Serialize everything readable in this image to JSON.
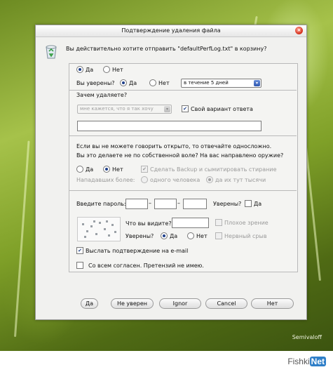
{
  "dialog": {
    "title": "Подтверждение удаления файла",
    "message": "Вы действительно хотите отправить \"defaultPerfLog.txt\" в корзину?"
  },
  "main_choice": {
    "yes": "Да",
    "no": "Нет",
    "selected": "yes"
  },
  "sure": {
    "label": "Вы уверены?",
    "yes": "Да",
    "no": "Нет",
    "selected": "yes",
    "when_value": "в течение 5 дней"
  },
  "why": {
    "label": "Зачем удаляете?",
    "reason_value": "мне кажется, что я так хочу",
    "own_answer_label": "Свой вариант ответа",
    "own_answer_checked": true,
    "own_answer_value": ""
  },
  "honest": {
    "line1": "Если вы не можете говорить открыто, то отвечайте односложно.",
    "line2": "Вы это делаете не по собственной воле? На вас направлено оружие?",
    "yes": "Да",
    "no": "Нет",
    "selected": "no",
    "backup_label": "Сделать Backup и сымитировать стирание",
    "backup_checked": true,
    "attackers_label": "Нападавших более:",
    "one_person": "одного человека",
    "thousands": "да их тут тысячи",
    "attackers_selected": "thousands"
  },
  "password": {
    "label": "Введите пароль:",
    "part1": "",
    "part2": "",
    "part3": "",
    "dash1": "–",
    "dash2": "–",
    "sure_label": "Уверены?",
    "sure_yes": "Да"
  },
  "captcha": {
    "question": "Что вы видите?",
    "answer": "",
    "bad_vision": "Плохое зрение",
    "sure_label": "Уверены?",
    "yes": "Да",
    "no": "Нет",
    "selected": "yes",
    "nervous": "Нервный срыв"
  },
  "send_confirmation": {
    "label": "Выслать подтверждение на e-mail",
    "checked": true
  },
  "agree": {
    "label": "Со всем согласен. Претензий не имею.",
    "checked": false
  },
  "buttons": {
    "yes": "Да",
    "not_sure": "Не уверен",
    "ignore": "Ignor",
    "cancel": "Cancel",
    "no": "Нет"
  },
  "credit": "Semivaloff",
  "brand": {
    "name": "Fishki",
    "net": "Net"
  }
}
